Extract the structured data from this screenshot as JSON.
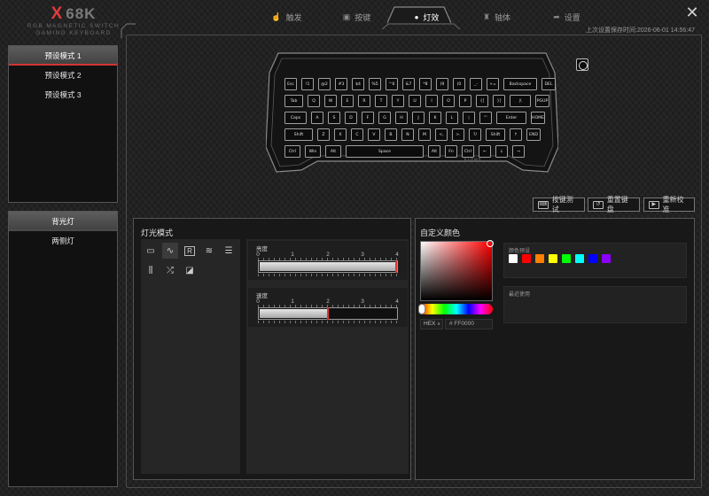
{
  "logo": {
    "mark": "X",
    "name": "68K",
    "line1": "RGB MAGNETIC SWITCH",
    "line2": "GAMING KEYBOARD"
  },
  "nav": {
    "items": [
      {
        "label": "触发",
        "icon": "hand-pointer-icon",
        "glyph": "☝"
      },
      {
        "label": "按键",
        "icon": "key-square-icon",
        "glyph": "▣"
      },
      {
        "label": "灯效",
        "icon": "bulb-icon",
        "glyph": "💡"
      },
      {
        "label": "轴体",
        "icon": "switch-shaft-icon",
        "glyph": "♜"
      },
      {
        "label": "设置",
        "icon": "share-arrow-icon",
        "glyph": "➦"
      }
    ],
    "active": "灯效"
  },
  "close_glyph": "✕",
  "last_saved": "上次设置保存时间:2026-06-01 14:56:47",
  "profiles": {
    "items": [
      "预设模式 1",
      "预设模式 2",
      "预设模式 3"
    ],
    "active": "预设模式 1"
  },
  "light_zones": {
    "items": [
      "背光灯",
      "两侧灯"
    ],
    "active": "背光灯"
  },
  "keyboard": {
    "rows": [
      [
        "Esc",
        "!1",
        "@2",
        "#3",
        "$4",
        "%5",
        "^6",
        "&7",
        "*8",
        "(9",
        ")0",
        "_-",
        "+=",
        "Backspace",
        "DEL"
      ],
      [
        "Tab",
        "Q",
        "W",
        "E",
        "R",
        "T",
        "Y",
        "U",
        "I",
        "O",
        "P",
        "{[",
        "}]",
        "|\\",
        "PGUP"
      ],
      [
        "Caps",
        "A",
        "S",
        "D",
        "F",
        "G",
        "H",
        "J",
        "K",
        "L",
        ":;",
        "\"'",
        "Enter",
        "HOME"
      ],
      [
        "Shift",
        "Z",
        "X",
        "C",
        "V",
        "B",
        "N",
        "M",
        "<,",
        ">.",
        "?/",
        "Shift",
        "↑",
        "END"
      ],
      [
        "Ctrl",
        "Win",
        "Alt",
        "Space",
        "Alt",
        "Fn",
        "Ctrl",
        "←",
        "↓",
        "→"
      ]
    ],
    "brand_mark": "ELOWS"
  },
  "actions": {
    "test": "按键测试",
    "reset": "重置键盘",
    "calibrate": "重新校准"
  },
  "lighting": {
    "title": "灯光模式",
    "effects": [
      {
        "icon": "static-light-icon",
        "glyph": "▭"
      },
      {
        "icon": "breathing-wave-icon",
        "glyph": "∿"
      },
      {
        "icon": "reactive-r-icon",
        "glyph": "R"
      },
      {
        "icon": "ripple-waves-icon",
        "glyph": "≋"
      },
      {
        "icon": "scan-lines-icon",
        "glyph": "☰"
      },
      {
        "icon": "equalizer-icon",
        "glyph": "⫼"
      },
      {
        "icon": "shuffle-icon",
        "glyph": "⤮"
      },
      {
        "icon": "diagonal-gradient-icon",
        "glyph": "◪"
      }
    ],
    "selected_effect": "breathing-wave-icon",
    "brightness": {
      "label": "亮度",
      "scale": [
        "0",
        "1",
        "2",
        "3",
        "4"
      ],
      "value": 4
    },
    "speed": {
      "label": "速度",
      "scale": [
        "0",
        "1",
        "2",
        "3",
        "4"
      ],
      "value": 2
    }
  },
  "custom_color": {
    "title": "自定义颜色",
    "format": "HEX",
    "hex_value": "# FF0000",
    "presets_label": "颜色预设",
    "presets": [
      "#ffffff",
      "#ff0000",
      "#ff7f00",
      "#ffff00",
      "#00ff00",
      "#00ffff",
      "#0000ff",
      "#8b00ff"
    ],
    "recent_label": "最近使用"
  }
}
